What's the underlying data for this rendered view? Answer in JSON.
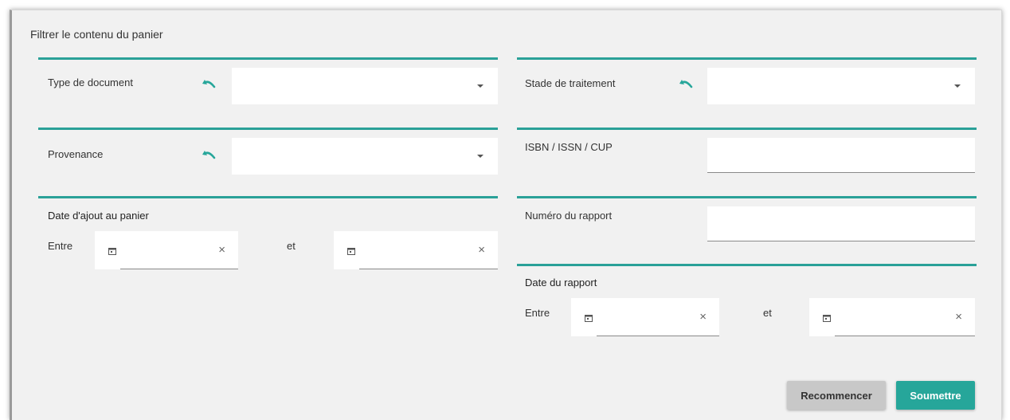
{
  "title": "Filtrer le contenu du panier",
  "fields": {
    "type_document": {
      "label": "Type de document",
      "value": ""
    },
    "stade_traitement": {
      "label": "Stade de traitement",
      "value": ""
    },
    "provenance": {
      "label": "Provenance",
      "value": ""
    },
    "isbn": {
      "label": "ISBN / ISSN / CUP",
      "value": ""
    },
    "numero_rapport": {
      "label": "Numéro du rapport",
      "value": ""
    }
  },
  "date_ajout": {
    "label": "Date d'ajout au panier",
    "between": "Entre",
    "and": "et"
  },
  "date_rapport": {
    "label": "Date du rapport",
    "between": "Entre",
    "and": "et"
  },
  "icons": {
    "reset": "undo-icon",
    "calendar": "calendar-icon",
    "clear": "close-icon",
    "dropdown": "chevron-down-icon",
    "clear_glyph": "×"
  },
  "buttons": {
    "reset": "Recommencer",
    "submit": "Soumettre"
  },
  "colors": {
    "accent": "#26a69a",
    "panel_bg": "#f1f1f1"
  }
}
